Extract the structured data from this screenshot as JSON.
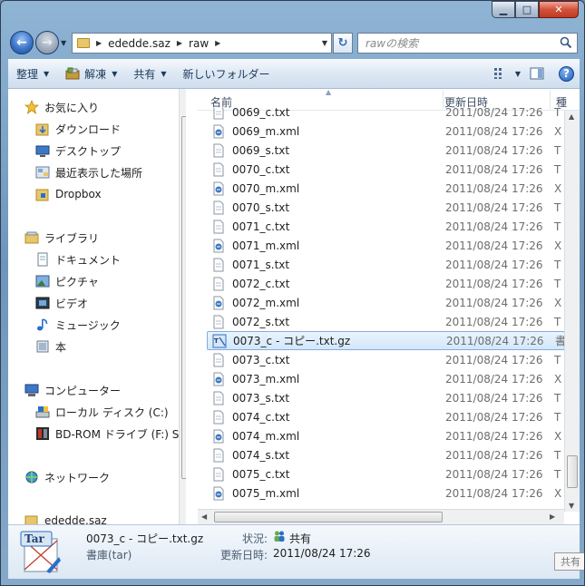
{
  "window": {
    "minimize_glyph": "▁",
    "maximize_glyph": "□",
    "close_glyph": "✕"
  },
  "address": {
    "crumbs": [
      "ededde.saz",
      "raw"
    ],
    "refresh_glyph": "↻"
  },
  "search": {
    "placeholder": "rawの検索"
  },
  "toolbar": {
    "organize": "整理",
    "extract": "解凍",
    "share": "共有",
    "new_folder": "新しいフォルダー",
    "help": "?"
  },
  "nav": {
    "favorites": "お気に入り",
    "downloads": "ダウンロード",
    "desktop": "デスクトップ",
    "recent": "最近表示した場所",
    "dropbox": "Dropbox",
    "libraries": "ライブラリ",
    "documents": "ドキュメント",
    "pictures": "ピクチャ",
    "videos": "ビデオ",
    "music": "ミュージック",
    "books": "本",
    "computer": "コンピューター",
    "local_disk": "ローカル ディスク (C:)",
    "bdrom": "BD-ROM ドライブ (F:) S",
    "network": "ネットワーク",
    "ededde": "ededde.saz"
  },
  "columns": {
    "name": "名前",
    "modified": "更新日時",
    "type": "種"
  },
  "files": [
    {
      "name": "0069_c.txt",
      "date": "2011/08/24 17:26",
      "type": "T",
      "kind": "txt"
    },
    {
      "name": "0069_m.xml",
      "date": "2011/08/24 17:26",
      "type": "X",
      "kind": "xml"
    },
    {
      "name": "0069_s.txt",
      "date": "2011/08/24 17:26",
      "type": "T",
      "kind": "txt"
    },
    {
      "name": "0070_c.txt",
      "date": "2011/08/24 17:26",
      "type": "T",
      "kind": "txt"
    },
    {
      "name": "0070_m.xml",
      "date": "2011/08/24 17:26",
      "type": "X",
      "kind": "xml"
    },
    {
      "name": "0070_s.txt",
      "date": "2011/08/24 17:26",
      "type": "T",
      "kind": "txt"
    },
    {
      "name": "0071_c.txt",
      "date": "2011/08/24 17:26",
      "type": "T",
      "kind": "txt"
    },
    {
      "name": "0071_m.xml",
      "date": "2011/08/24 17:26",
      "type": "X",
      "kind": "xml"
    },
    {
      "name": "0071_s.txt",
      "date": "2011/08/24 17:26",
      "type": "T",
      "kind": "txt"
    },
    {
      "name": "0072_c.txt",
      "date": "2011/08/24 17:26",
      "type": "T",
      "kind": "txt"
    },
    {
      "name": "0072_m.xml",
      "date": "2011/08/24 17:26",
      "type": "X",
      "kind": "xml"
    },
    {
      "name": "0072_s.txt",
      "date": "2011/08/24 17:26",
      "type": "T",
      "kind": "txt"
    },
    {
      "name": "0073_c - コピー.txt.gz",
      "date": "2011/08/24 17:26",
      "type": "書",
      "kind": "gz",
      "selected": true
    },
    {
      "name": "0073_c.txt",
      "date": "2011/08/24 17:26",
      "type": "T",
      "kind": "txt"
    },
    {
      "name": "0073_m.xml",
      "date": "2011/08/24 17:26",
      "type": "X",
      "kind": "xml"
    },
    {
      "name": "0073_s.txt",
      "date": "2011/08/24 17:26",
      "type": "T",
      "kind": "txt"
    },
    {
      "name": "0074_c.txt",
      "date": "2011/08/24 17:26",
      "type": "T",
      "kind": "txt"
    },
    {
      "name": "0074_m.xml",
      "date": "2011/08/24 17:26",
      "type": "X",
      "kind": "xml"
    },
    {
      "name": "0074_s.txt",
      "date": "2011/08/24 17:26",
      "type": "T",
      "kind": "txt"
    },
    {
      "name": "0075_c.txt",
      "date": "2011/08/24 17:26",
      "type": "T",
      "kind": "txt"
    },
    {
      "name": "0075_m.xml",
      "date": "2011/08/24 17:26",
      "type": "X",
      "kind": "xml"
    }
  ],
  "details": {
    "name": "0073_c - コピー.txt.gz",
    "type": "書庫(tar)",
    "status_label": "状況:",
    "status_value": "共有",
    "date_label": "更新日時:",
    "date_value": "2011/08/24 17:26",
    "icon_text": "Tar"
  },
  "tooltip": "共有"
}
